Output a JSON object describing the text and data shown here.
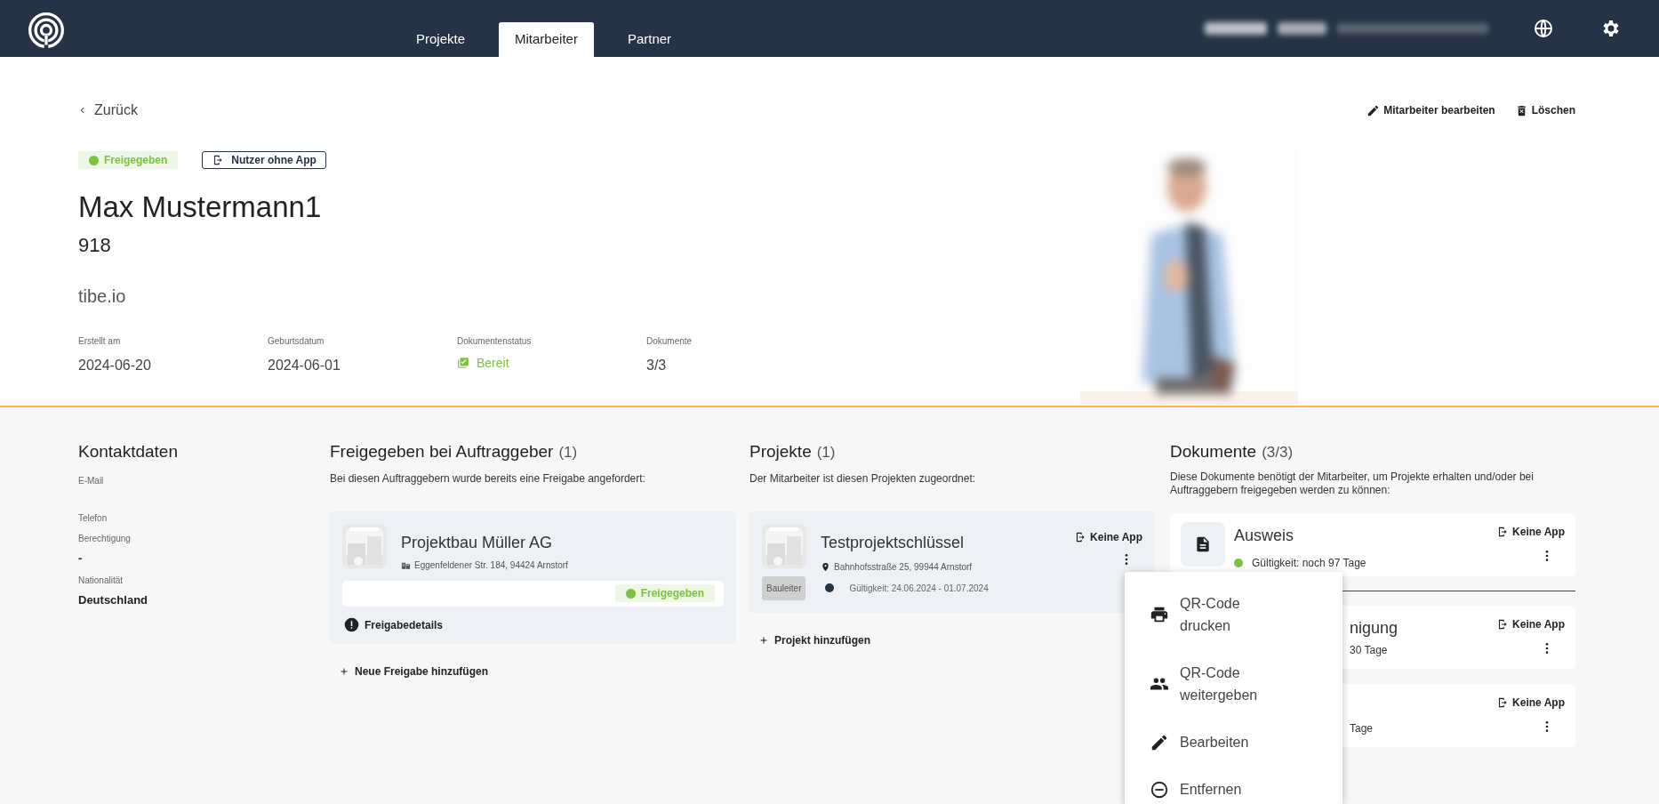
{
  "nav": {
    "tabs": [
      {
        "label": "Projekte",
        "selected": false
      },
      {
        "label": "Mitarbeiter",
        "selected": true
      },
      {
        "label": "Partner",
        "selected": false
      }
    ]
  },
  "header": {
    "back": "Zurück",
    "actions": [
      {
        "kind": "edit",
        "label": "Mitarbeiter bearbeiten"
      },
      {
        "kind": "delete",
        "label": "Löschen"
      }
    ],
    "status_badge": {
      "label": "Freigegeben",
      "color": "#7cc242"
    },
    "app_badge": "Nutzer ohne App",
    "name": "Max Mustermann1",
    "number": "918",
    "company": "tibe.io",
    "meta": [
      {
        "label": "Erstellt am",
        "value": "2024-06-20",
        "kind": "text"
      },
      {
        "label": "Geburtsdatum",
        "value": "2024-06-01",
        "kind": "text"
      },
      {
        "label": "Dokumentenstatus",
        "value": "Bereit",
        "kind": "status"
      },
      {
        "label": "Dokumente",
        "value": "3/3",
        "kind": "text"
      }
    ]
  },
  "contact": {
    "title": "Kontaktdaten",
    "fields": [
      {
        "label": "E-Mail"
      },
      {
        "label": "Telefon"
      },
      {
        "label": "Berechtigung",
        "value": "-"
      },
      {
        "label": "Nationalität",
        "value": "Deutschland"
      }
    ]
  },
  "clients": {
    "title": "Freigegeben bei Auftraggeber",
    "count": "(1)",
    "description": "Bei diesen Auftraggebern wurde bereits eine Freigabe angefordert:",
    "items": [
      {
        "name": "Projektbau Müller AG",
        "address": "Eggenfeldener Str. 184, 94424 Arnstorf",
        "status": "Freigegeben",
        "color": "#7cc242",
        "details": "Freigabedetails"
      }
    ],
    "add": "Neue Freigabe hinzufügen"
  },
  "projects": {
    "title": "Projekte",
    "count": "(1)",
    "description": "Der Mitarbeiter ist diesen Projekten zugeordnet:",
    "items": [
      {
        "name": "Testprojektschlüssel",
        "address": "Bahnhofsstraße 25, 99944 Arnstorf",
        "app": "Keine App",
        "role": "Bauleiter",
        "color": "#263245",
        "validity": "Gültigkeit: 24.06.2024 - 01.07.2024"
      }
    ],
    "add": "Projekt hinzufügen"
  },
  "documents": {
    "title": "Dokumente",
    "count": "(3/3)",
    "description": "Diese Dokumente benötigt der Mitarbeiter, um Projekte erhalten und/oder bei Auftraggebern freigegeben werden zu können:",
    "items": [
      {
        "kind": "full",
        "title": "Ausweis",
        "validity": "Gültigkeit: noch 97 Tage",
        "color": "#7cc242",
        "app": "Keine App"
      },
      {
        "kind": "covered",
        "title": "nigung",
        "validity": "30 Tage",
        "app": "Keine App"
      },
      {
        "kind": "covered",
        "validity": "Tage",
        "app": "Keine App"
      }
    ]
  },
  "menu": {
    "items": [
      {
        "kind": "print",
        "label": "QR-Code drucken"
      },
      {
        "kind": "share",
        "label": "QR-Code weitergeben"
      },
      {
        "kind": "edit",
        "label": "Bearbeiten"
      },
      {
        "kind": "remove",
        "label": "Entfernen"
      }
    ]
  }
}
